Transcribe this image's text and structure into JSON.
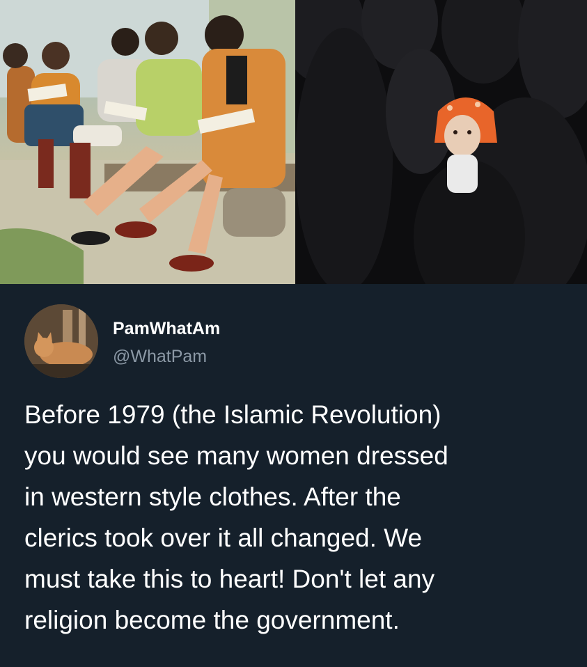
{
  "media": {
    "left_photo_icon": "photo-women-reading-on-bench",
    "right_photo_icon": "photo-child-among-veiled-women"
  },
  "tweet": {
    "avatar_icon": "cat-avatar",
    "display_name": "PamWhatAm",
    "handle": "@WhatPam",
    "text": "Before 1979 (the Islamic Revolution)\nyou would see many women dressed\nin western style clothes.  After the\nclerics took over it all changed. We\nmust take this to heart!  Don't let any\nreligion become the government."
  },
  "colors": {
    "background": "#15202b",
    "secondary_text": "#8b98a5",
    "primary_text": "#ffffff",
    "headscarf": "#e8652a"
  }
}
